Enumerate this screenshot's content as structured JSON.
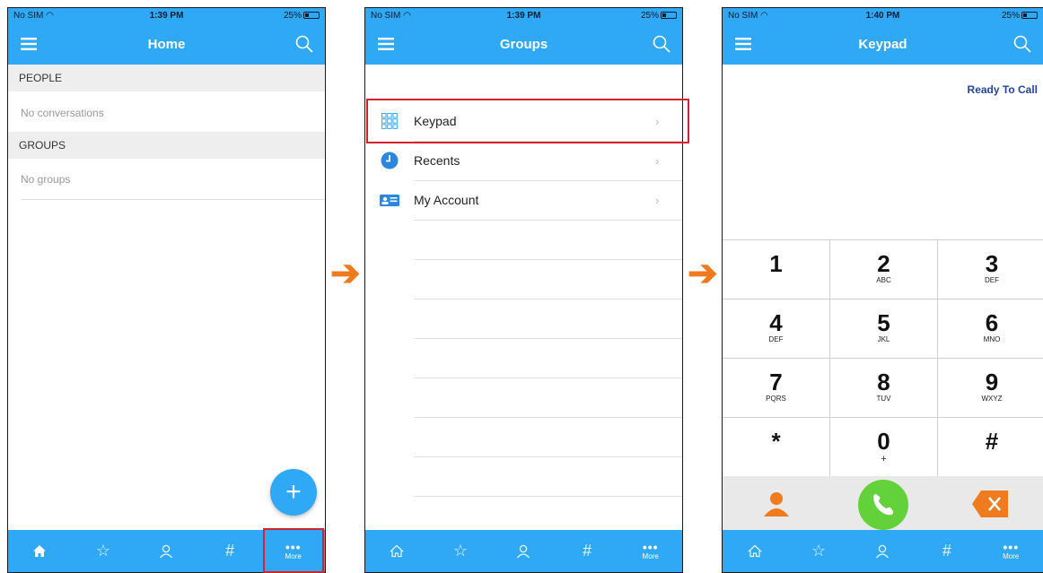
{
  "status_bars": [
    {
      "carrier": "No SIM",
      "time": "1:39 PM",
      "battery": "25%"
    },
    {
      "carrier": "No SIM",
      "time": "1:39 PM",
      "battery": "25%"
    },
    {
      "carrier": "No SIM",
      "time": "1:40 PM",
      "battery": "25%"
    }
  ],
  "home": {
    "title": "Home",
    "people_header": "PEOPLE",
    "people_empty": "No conversations",
    "groups_header": "GROUPS",
    "groups_empty": "No groups",
    "fab_label": "+"
  },
  "groups": {
    "title": "Groups",
    "items": [
      {
        "label": "Keypad",
        "icon": "keypad-grid-icon"
      },
      {
        "label": "Recents",
        "icon": "clock-icon"
      },
      {
        "label": "My Account",
        "icon": "id-card-icon"
      }
    ]
  },
  "keypad": {
    "title": "Keypad",
    "status": "Ready To Call",
    "keys": [
      {
        "num": "1",
        "letters": ""
      },
      {
        "num": "2",
        "letters": "ABC"
      },
      {
        "num": "3",
        "letters": "DEF"
      },
      {
        "num": "4",
        "letters": "DEF"
      },
      {
        "num": "5",
        "letters": "JKL"
      },
      {
        "num": "6",
        "letters": "MNO"
      },
      {
        "num": "7",
        "letters": "PQRS"
      },
      {
        "num": "8",
        "letters": "TUV"
      },
      {
        "num": "9",
        "letters": "WXYZ"
      },
      {
        "num": "*",
        "letters": ""
      },
      {
        "num": "0",
        "letters": "+"
      },
      {
        "num": "#",
        "letters": ""
      }
    ]
  },
  "tabbar": {
    "more_label": "More",
    "hash_label": "#"
  },
  "colors": {
    "primary": "#2fa9f5",
    "highlight": "#d9212c",
    "arrow": "#f07a1e",
    "call": "#63d13a",
    "contact": "#f07a1e",
    "delete": "#f07a1e"
  }
}
